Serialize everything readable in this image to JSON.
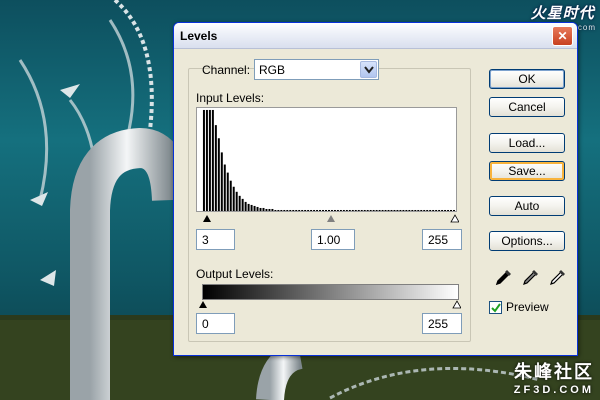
{
  "watermarks": {
    "top_brand": "火星时代",
    "top_url": "www.hxsd.com",
    "bottom_brand": "朱峰社区",
    "bottom_url": "ZF3D.COM"
  },
  "dialog": {
    "title": "Levels",
    "close_glyph": "✕",
    "channel_label": "Channel:",
    "channel_value": "RGB",
    "input_levels_label": "Input Levels:",
    "input_levels": {
      "black": "3",
      "gamma": "1.00",
      "white": "255"
    },
    "output_levels_label": "Output Levels:",
    "output_levels": {
      "black": "0",
      "white": "255"
    },
    "buttons": {
      "ok": "OK",
      "cancel": "Cancel",
      "load": "Load...",
      "save": "Save...",
      "auto": "Auto",
      "options": "Options..."
    },
    "preview_label": "Preview",
    "preview_checked": true
  },
  "histogram_profile": [
    100,
    100,
    100,
    100,
    85,
    72,
    58,
    46,
    38,
    30,
    24,
    19,
    15,
    12,
    9,
    7,
    6,
    5,
    4,
    3,
    3,
    2,
    2,
    2,
    1,
    1,
    1,
    1,
    1,
    1,
    1,
    1,
    1,
    1,
    1,
    1,
    1,
    1,
    1,
    1,
    1,
    1,
    1,
    1,
    1,
    1,
    1,
    1,
    1,
    1,
    1,
    1,
    1,
    1,
    1,
    1,
    1,
    1,
    1,
    1,
    1,
    1,
    1,
    1,
    1,
    1,
    1,
    1,
    1,
    1,
    1,
    1,
    1,
    1,
    1,
    1,
    1,
    1,
    1,
    1,
    1,
    1,
    1,
    1,
    1,
    1
  ],
  "icons": {
    "eyedropper_black": "eyedropper-black-icon",
    "eyedropper_gray": "eyedropper-gray-icon",
    "eyedropper_white": "eyedropper-white-icon",
    "dropdown": "chevron-down-icon"
  },
  "colors": {
    "titlebar_border": "#0831d9",
    "dialog_bg": "#ece9d8",
    "save_focus": "#f8b33c"
  }
}
